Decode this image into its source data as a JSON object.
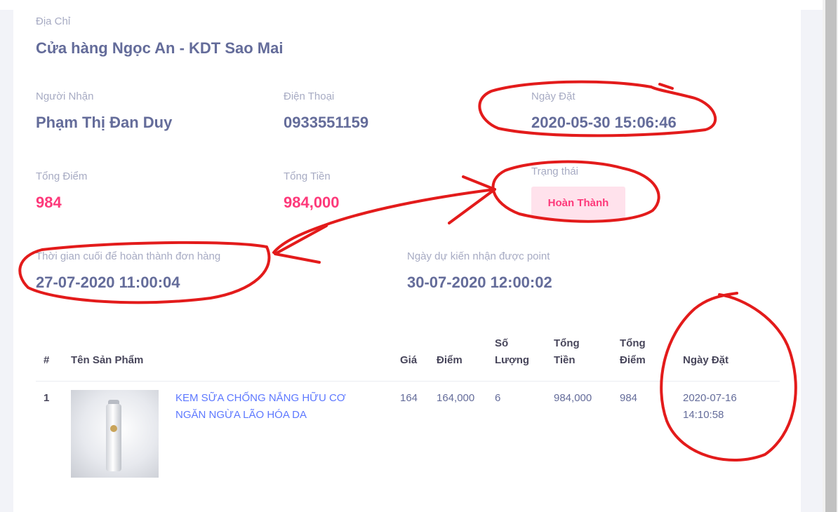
{
  "address": {
    "label": "Địa Chỉ",
    "value": "Cửa hàng Ngọc An - KDT Sao Mai"
  },
  "recipient": {
    "label": "Người Nhận",
    "value": "Phạm Thị Đan Duy"
  },
  "phone": {
    "label": "Điện Thoại",
    "value": "0933551159"
  },
  "order_date": {
    "label": "Ngày Đặt",
    "value": "2020-05-30 15:06:46"
  },
  "total_points": {
    "label": "Tổng Điểm",
    "value": "984"
  },
  "total_amount": {
    "label": "Tổng Tiền",
    "value": "984,000"
  },
  "status": {
    "label": "Trạng thái",
    "value": "Hoàn Thành"
  },
  "completion_deadline": {
    "label": "Thời gian cuối để hoàn thành đơn hàng",
    "value": "27-07-2020 11:00:04"
  },
  "expected_point_date": {
    "label": "Ngày dự kiến nhận được point",
    "value": "30-07-2020 12:00:02"
  },
  "table": {
    "headers": {
      "index": "#",
      "product_name": "Tên Sản Phẩm",
      "price": "Giá",
      "points": "Điểm",
      "quantity": "Số Lượng",
      "total_amount": "Tổng Tiền",
      "total_points": "Tổng Điểm",
      "order_date": "Ngày Đặt"
    },
    "rows": [
      {
        "index": "1",
        "product_name": "KEM SỮA CHỐNG NẮNG HỮU CƠ NGĂN NGỪA LÃO HÓA DA",
        "price": "164",
        "points": "164,000",
        "quantity": "6",
        "total_amount": "984,000",
        "total_points": "984",
        "order_date": "2020-07-16 14:10:58"
      }
    ]
  },
  "colors": {
    "accent_pink": "#fd397a",
    "annotation_red": "#e31b1b",
    "link_blue": "#5d78ff"
  }
}
